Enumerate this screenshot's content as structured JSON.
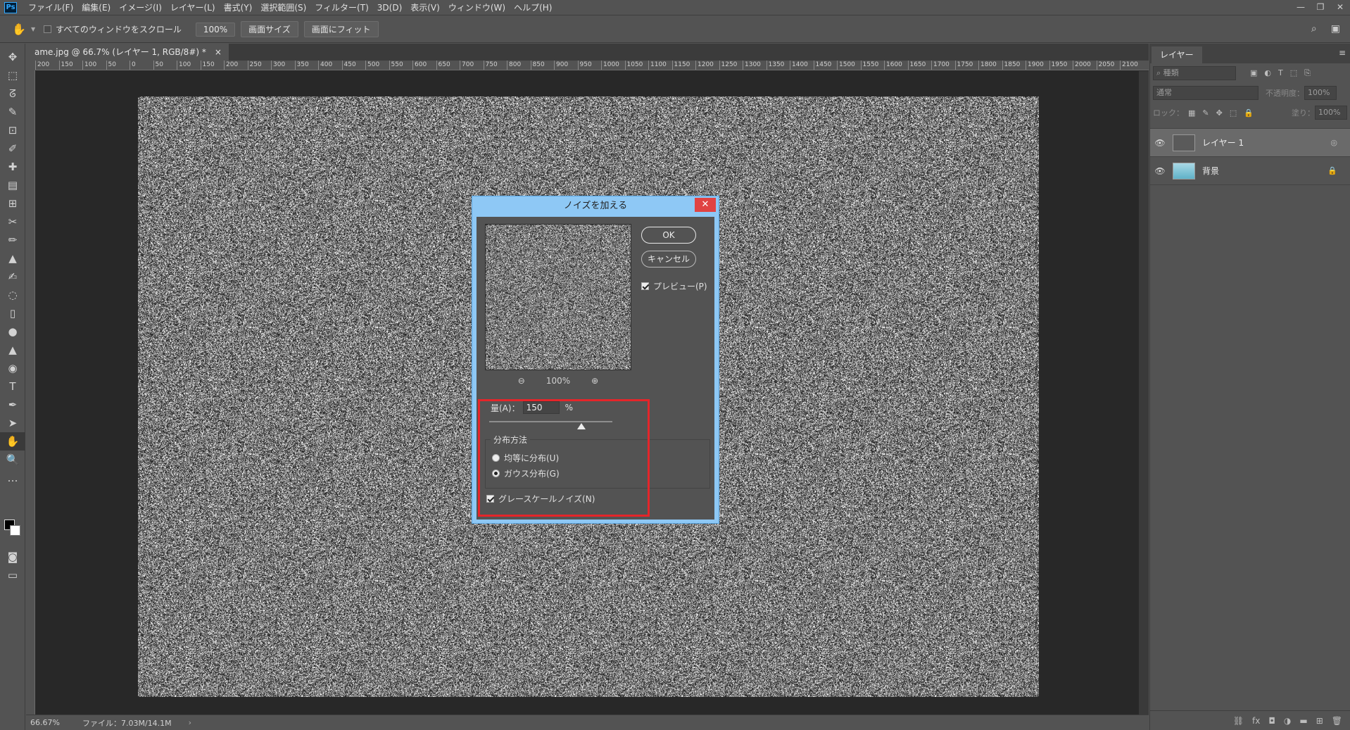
{
  "app": {
    "logo": "Ps"
  },
  "menu": [
    "ファイル(F)",
    "編集(E)",
    "イメージ(I)",
    "レイヤー(L)",
    "書式(Y)",
    "選択範囲(S)",
    "フィルター(T)",
    "3D(D)",
    "表示(V)",
    "ウィンドウ(W)",
    "ヘルプ(H)"
  ],
  "window_controls": {
    "minimize": "—",
    "restore": "❐",
    "close": "✕"
  },
  "options": {
    "tool_icon": "hand-icon",
    "scroll_all_label": "すべてのウィンドウをスクロール",
    "zoom_value": "100%",
    "fill_screen_label": "画面サイズ",
    "fit_screen_label": "画面にフィット",
    "search_icon": "⌕",
    "workspace_icon": "▣"
  },
  "tools": [
    "✥",
    "⬚",
    "ᘔ",
    "✎",
    "⊡",
    "✐",
    "✚",
    "▤",
    "⊞",
    "✂",
    "✏",
    "▲",
    "✍",
    "◌",
    "▯",
    "●",
    "▲",
    "◉",
    "T",
    "✒",
    "➤",
    "✋",
    "🔍",
    "…"
  ],
  "document": {
    "tab_title": "ame.jpg @ 66.7% (レイヤー 1, RGB/8#) *",
    "tab_close": "×",
    "ruler_ticks": [
      "200",
      "150",
      "100",
      "50",
      "0",
      "50",
      "100",
      "150",
      "200",
      "250",
      "300",
      "350",
      "400",
      "450",
      "500",
      "550",
      "600",
      "650",
      "700",
      "750",
      "800",
      "850",
      "900",
      "950",
      "1000",
      "1050",
      "1100",
      "1150",
      "1200",
      "1250",
      "1300",
      "1350",
      "1400",
      "1450",
      "1500",
      "1550",
      "1600",
      "1650",
      "1700",
      "1750",
      "1800",
      "1850",
      "1900",
      "1950",
      "2000",
      "2050",
      "2100"
    ]
  },
  "status": {
    "zoom": "66.67%",
    "file_info": "ファイル：7.03M/14.1M",
    "arrow": "›"
  },
  "layers_panel": {
    "tab": "レイヤー",
    "menu_icon": "≡",
    "filter_placeholder": "⌕ 種類",
    "filter_icons": [
      "▣",
      "◐",
      "T",
      "⬚",
      "⎘"
    ],
    "blend_mode": "通常",
    "opacity_label": "不透明度：",
    "opacity_value": "100%",
    "lock_label": "ロック：",
    "lock_icons": [
      "▦",
      "✎",
      "✥",
      "⬚",
      "🔒"
    ],
    "fill_label": "塗り：",
    "fill_value": "100%",
    "layers": [
      {
        "name": "レイヤー 1",
        "eye": "👁",
        "right": "◎",
        "selected": true
      },
      {
        "name": "背景",
        "eye": "👁",
        "right": "🔒",
        "selected": false
      }
    ],
    "footer_icons": [
      "⛓",
      "fx",
      "◘",
      "◑",
      "▬",
      "⊞",
      "🗑"
    ]
  },
  "dialog": {
    "title": "ノイズを加える",
    "close": "✕",
    "ok_label": "OK",
    "cancel_label": "キャンセル",
    "preview_label": "プレビュー(P)",
    "preview_checked": true,
    "zoom_out_icon": "⊖",
    "zoom_in_icon": "⊕",
    "preview_zoom": "100%",
    "amount_label": "量(A)：",
    "amount_value": "150",
    "amount_unit": "%",
    "amount_slider_fraction": 0.75,
    "distribution_legend": "分布方法",
    "uniform_label": "均等に分布(U)",
    "gaussian_label": "ガウス分布(G)",
    "selected_distribution": "gaussian",
    "grayscale_label": "グレースケールノイズ(N)",
    "grayscale_checked": true
  },
  "colors": {
    "highlight": "#e5252a",
    "dialog_frame": "#8ec8f5",
    "close_button": "#e04343"
  }
}
